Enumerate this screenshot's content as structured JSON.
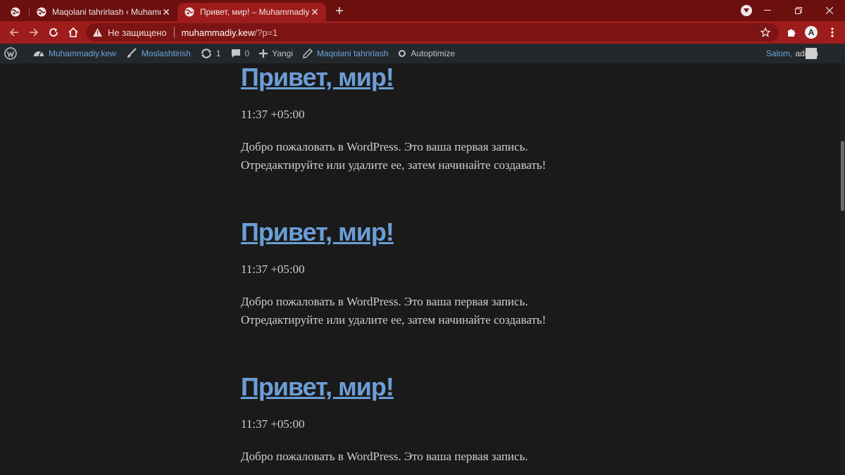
{
  "browser": {
    "tabs": [
      {
        "title": "Maqolani tahrirlash ‹ Muhammadiy.kew — WordPress",
        "active": false
      },
      {
        "title": "Привет, мир! – Muhammadiy.kew",
        "active": true
      }
    ],
    "address": {
      "security_label": "Не защищено",
      "host": "muhammadiy.kew",
      "path": "/?p=1"
    },
    "colors": {
      "tabstrip": "#6b0f0f",
      "toolbar": "#9e1c1c",
      "omnibox": "#7d1414"
    }
  },
  "adminbar": {
    "site_name": "Muhammadiy.kew",
    "customize": "Moslashtirish",
    "updates_count": "1",
    "comments_count": "0",
    "new_label": "Yangi",
    "edit_post": "Maqolani tahrirlash",
    "autoptimize": "Autoptimize",
    "greeting": "Salom,",
    "username": "admin"
  },
  "posts": [
    {
      "title": "Привет, мир!",
      "time": "11:37 +05:00",
      "body_line1": "Добро пожаловать в WordPress. Это ваша первая запись.",
      "body_line2": "Отредактируйте или удалите ее, затем начинайте создавать!"
    },
    {
      "title": "Привет, мир!",
      "time": "11:37 +05:00",
      "body_line1": "Добро пожаловать в WordPress. Это ваша первая запись.",
      "body_line2": "Отредактируйте или удалите ее, затем начинайте создавать!"
    },
    {
      "title": "Привет, мир!",
      "time": "11:37 +05:00",
      "body_line1": "Добро пожаловать в WordPress. Это ваша первая запись.",
      "body_line2": ""
    }
  ],
  "theme": {
    "link": "#6b9ed6",
    "text": "#cfcfcf",
    "background": "#1a1a1a"
  }
}
